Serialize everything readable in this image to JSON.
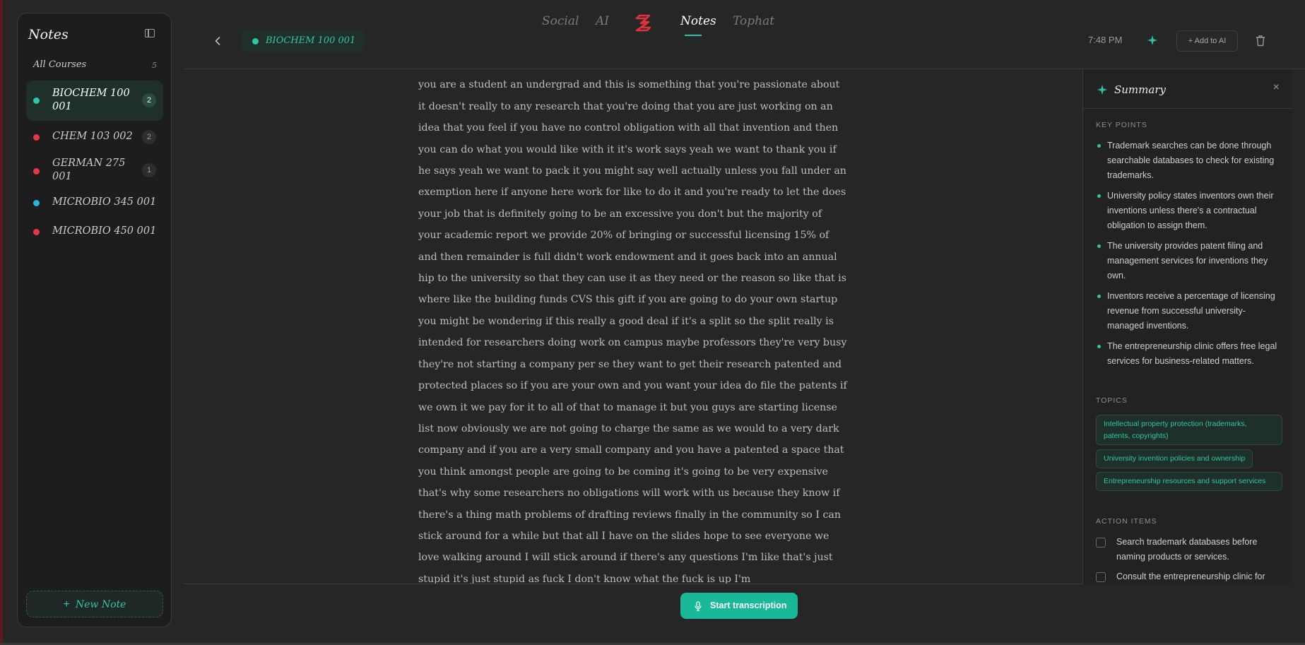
{
  "sidebar": {
    "title": "Notes",
    "all_courses": {
      "label": "All Courses",
      "count": "5"
    },
    "courses": [
      {
        "name": "BIOCHEM 100 001",
        "count": "2",
        "color": "#2ec4a6",
        "active": true
      },
      {
        "name": "CHEM 103 002",
        "count": "2",
        "color": "#e63946"
      },
      {
        "name": "GERMAN 275 001",
        "count": "1",
        "color": "#e63946"
      },
      {
        "name": "MICROBIO 345 001",
        "count": "",
        "color": "#2ab4e6"
      },
      {
        "name": "MICROBIO 450 001",
        "count": "",
        "color": "#e63946"
      }
    ],
    "new_note": "New Note"
  },
  "header": {
    "course_chip": "BIOCHEM 100 001",
    "nav": [
      "Social",
      "AI",
      "Notes",
      "Tophat"
    ],
    "active_nav": "Notes",
    "time": "7:48 PM",
    "add_to_ai": "Add to AI"
  },
  "transcript": {
    "text": "a reality as long as the university is not and there's no other you on that invention if you are a student an undergrad and this is something that you're passionate about it doesn't really to any research that you're doing that you are just working on an idea that you feel if you have no control obligation with all that invention and then you can do what you would like with it it's work says yeah we want to thank you if he says yeah we want to pack it you might say well actually unless you fall under an exemption here if anyone here work for like to do it and you're ready to let the does your job that is definitely going to be an excessive you don't but the majority of your academic report we provide 20% of bringing or successful licensing 15% of and then remainder is full didn't work endowment and it goes back into an annual hip to the university so that they can use it as they need or the reason so like that is where like the building funds CVS this gift if you are going to do your own startup you might be wondering if this really a good deal if it's a split so the split really is intended for researchers doing work on campus maybe professors they're very busy they're not starting a company per se they want to get their research patented and protected places so if you are your own and you want your idea do file the patents if we own it we pay for it to all of that to manage it but you guys are starting license list now obviously we are not going to charge the same as we would to a very dark company and if you are a very small company and you have a patented a space that you think amongst people are going to be coming it's going to be very expensive that's why some researchers no obligations will work with us because they know if there's a thing math problems of drafting reviews finally in the community so I can stick around for a while but that all I have on the slides hope to see everyone we love walking around I will stick around if there's any questions I'm like that's just stupid it's just stupid as fuck I don't know what the fuck is up I'm"
  },
  "controls": {
    "start_transcription": "Start transcription"
  },
  "summary": {
    "title": "Summary",
    "close": "×",
    "key_points_label": "KEY POINTS",
    "key_points": [
      "Trademark searches can be done through searchable databases to check for existing trademarks.",
      "University policy states inventors own their inventions unless there's a contractual obligation to assign them.",
      "The university provides patent filing and management services for inventions they own.",
      "Inventors receive a percentage of licensing revenue from successful university-managed inventions.",
      "The entrepreneurship clinic offers free legal services for business-related matters."
    ],
    "topics_label": "TOPICS",
    "topics": [
      "Intellectual property protection (trademarks, patents, copyrights)",
      "University invention policies and ownership",
      "Entrepreneurship resources and support services"
    ],
    "action_items_label": "ACTION ITEMS",
    "action_items": [
      "Search trademark databases before naming products or services.",
      "Consult the entrepreneurship clinic for"
    ]
  },
  "colors": {
    "accent": "#2ec4a6",
    "background": "#262626",
    "sidebar": "#1d1d1d",
    "alert": "#e63946"
  },
  "icons": [
    "sidebar-toggle-icon",
    "back-chevron-icon",
    "app-logo-icon",
    "sparkle-icon",
    "trash-icon",
    "microphone-icon",
    "plus-icon",
    "close-icon"
  ]
}
